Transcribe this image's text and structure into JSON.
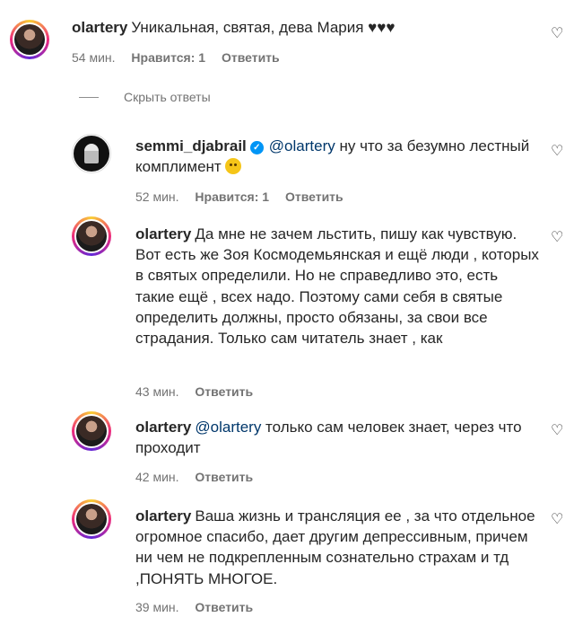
{
  "comments": [
    {
      "username": "olartery",
      "text": "Уникальная, святая, дева Мария ♥♥♥",
      "time": "54 мин.",
      "likes": "Нравится: 1",
      "reply": "Ответить"
    },
    {
      "username": "semmi_djabrail",
      "mention": "@olartery",
      "text": " ну что за безумно лестный комплимент ",
      "time": "52 мин.",
      "likes": "Нравится: 1",
      "reply": "Ответить"
    },
    {
      "username": "olartery",
      "text": "Да мне не зачем льстить, пишу как чувствую. Вот есть же Зоя Космодемьянская и ещё люди , которых в святых определили. Но не справедливо это, есть такие ещё , всех надо. Поэтому сами себя в святые определить должны, просто обязаны, за свои все страдания. Только сам читатель знает , как",
      "time": "43 мин.",
      "reply": "Ответить"
    },
    {
      "username": "olartery",
      "mention": "@olartery",
      "text": " только сам человек знает, через что проходит",
      "time": "42 мин.",
      "reply": "Ответить"
    },
    {
      "username": "olartery",
      "text": "Ваша жизнь и трансляция ее , за что отдельное огромное спасибо, дает другим депрессивным, причем ни чем не подкрепленным сознательно страхам и тд ,ПОНЯТЬ МНОГОЕ.",
      "time": "39 мин.",
      "reply": "Ответить"
    }
  ],
  "hide_replies": "Скрыть ответы"
}
